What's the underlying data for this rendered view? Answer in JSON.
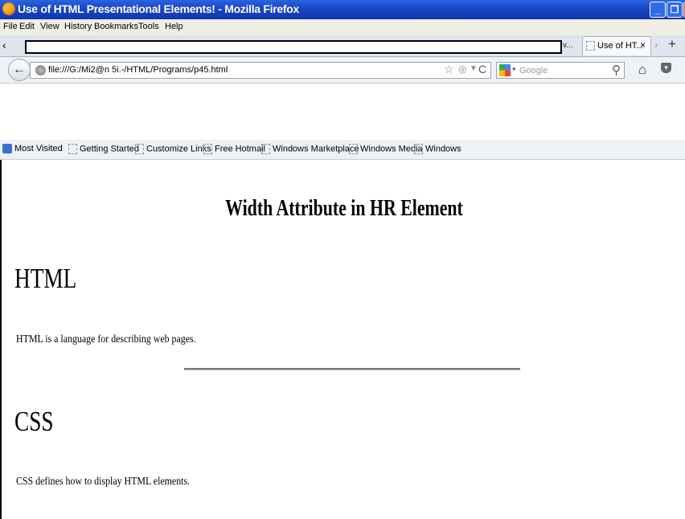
{
  "window": {
    "title": "Use of HTML Presentational Elements! - Mozilla Firefox",
    "buttons": {
      "minimize": "_",
      "maximize": "❐",
      "close": "X"
    }
  },
  "menu": [
    "File",
    "Edit",
    "View",
    "History",
    "Bookmarks",
    "Tools",
    "Help"
  ],
  "tabs": {
    "overflow_tab": "v...",
    "active_tab": "Use of HT...",
    "close_glyph": "×"
  },
  "nav": {
    "url": "file:///G:/Mi2@n 5i.-/HTML/Programs/p45.html",
    "search_placeholder": "Google"
  },
  "bookmarks": [
    "Most Visited",
    "Getting Started",
    "Customize Links",
    "Free Hotmail",
    "Windows Marketplace",
    "Windows Media",
    "Windows"
  ],
  "page": {
    "heading": "Width Attribute in HR Element",
    "section1_title": "HTML",
    "section1_text": "HTML is a language for describing web pages.",
    "section2_title": "CSS",
    "section2_text": "CSS defines how to display HTML elements."
  }
}
